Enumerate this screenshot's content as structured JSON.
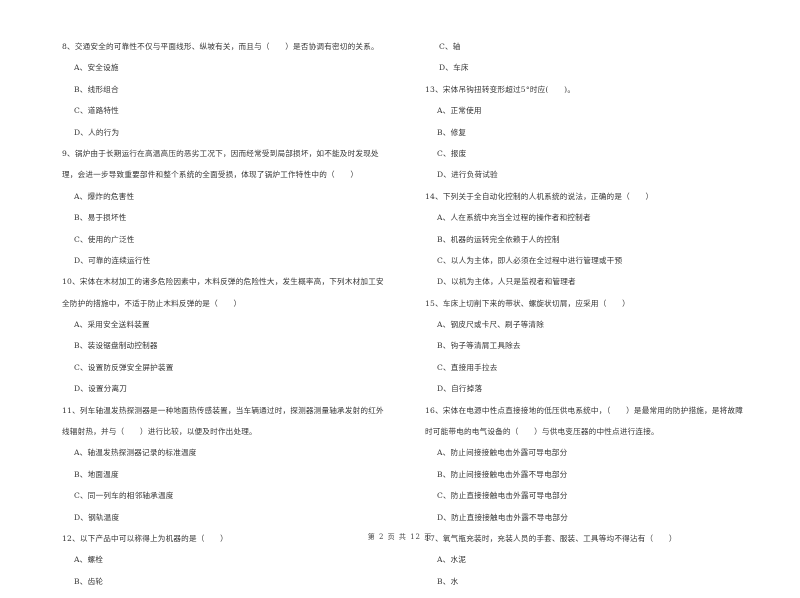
{
  "left_column": {
    "q8": {
      "lines": [
        "8、交通安全的可靠性不仅与平面线形、纵坡有关，而且与（　　）是否协调有密切的关系。"
      ],
      "options": [
        "A、安全设施",
        "B、线形组合",
        "C、道路特性",
        "D、人的行为"
      ]
    },
    "q9": {
      "lines": [
        "9、锅炉由于长期运行在高温高压的恶劣工况下，因而经常受到局部损坏，如不能及时发现处",
        "理，会进一步导致重要部件和整个系统的全面受损，体现了锅炉工作特性中的（　　）"
      ],
      "options": [
        "A、爆炸的危害性",
        "B、易于损坏性",
        "C、使用的广泛性",
        "D、可靠的连续运行性"
      ]
    },
    "q10": {
      "lines": [
        "10、宋体在木材加工的诸多危险因素中，木料反弹的危险性大，发生概率高，下列木材加工安",
        "全防护的措施中，不适于防止木料反弹的是（　　）"
      ],
      "options": [
        "A、采用安全送料装置",
        "B、装设锯盘制动控制器",
        "C、设置防反弹安全屏护装置",
        "D、设置分离刀"
      ]
    },
    "q11": {
      "lines": [
        "11、列车轴温发热探测器是一种地面热传感装置，当车辆通过时，探测器测量轴承发射的红外",
        "线辐射热，并与（　　）进行比较，以便及时作出处理。"
      ],
      "options": [
        "A、轴温发热探测器记录的标准温度",
        "B、地面温度",
        "C、同一列车的相邻轴承温度",
        "D、钢轨温度"
      ]
    },
    "q12": {
      "lines": [
        "12、以下产品中可以称得上为机器的是（　　）"
      ],
      "options": [
        "A、螺栓",
        "B、齿轮"
      ]
    }
  },
  "right_column": {
    "q12_cont": {
      "options": [
        "C、轴",
        "D、车床"
      ]
    },
    "q13": {
      "lines": [
        "13、宋体吊钩扭转变形超过5°时应(　　)。"
      ],
      "options": [
        "A、正常使用",
        "B、修复",
        "C、报废",
        "D、进行负荷试验"
      ]
    },
    "q14": {
      "lines": [
        "14、下列关于全自动化控制的人机系统的说法，正确的是（　　）"
      ],
      "options": [
        "A、人在系统中充当全过程的操作者和控制者",
        "B、机器的运转完全依赖于人的控制",
        "C、以人为主体，即人必须在全过程中进行管理或干预",
        "D、以机为主体，人只是监视者和管理者"
      ]
    },
    "q15": {
      "lines": [
        "15、车床上切削下来的带状、螺旋状切屑，应采用（　　）"
      ],
      "options": [
        "A、钢皮尺或卡尺、刷子等清除",
        "B、钩子等清屑工具除去",
        "C、直接用手拉去",
        "D、自行掉落"
      ]
    },
    "q16": {
      "lines": [
        "16、宋体在电源中性点直接接地的低压供电系统中，（　　）是最常用的防护措施，是将故障",
        "时可能带电的电气设备的（　　）与供电变压器的中性点进行连接。"
      ],
      "options": [
        "A、防止间接接触电击外露可导电部分",
        "B、防止间接接触电击外露不导电部分",
        "C、防止直接接触电击外露可导电部分",
        "D、防止直接接触电击外露不导电部分"
      ]
    },
    "q17": {
      "lines": [
        "17、氧气瓶充装时，充装人员的手套、服装、工具等均不得沾有（　　）"
      ],
      "options": [
        "A、水泥",
        "B、水"
      ]
    }
  },
  "footer": {
    "page_indicator": "第 2 页 共 12 页"
  }
}
